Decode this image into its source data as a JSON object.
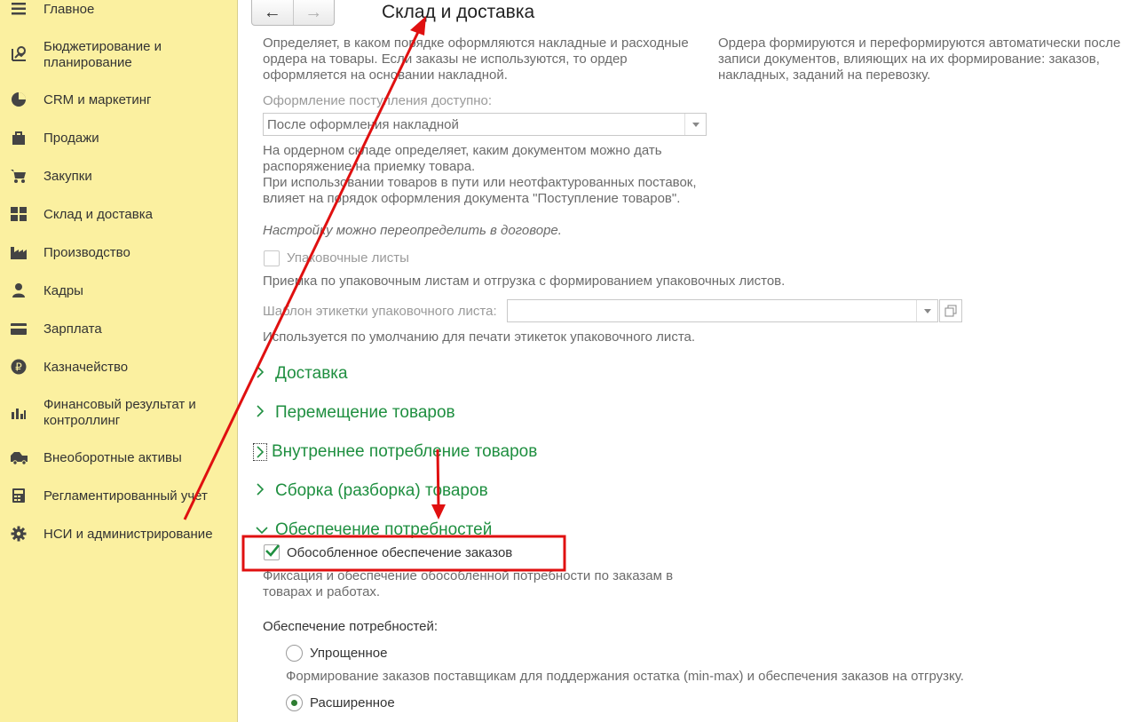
{
  "sidebar": {
    "items": [
      {
        "label": "Главное",
        "icon": "menu-icon"
      },
      {
        "label": "Бюджетирование и планирование",
        "icon": "budget-icon"
      },
      {
        "label": "CRM и маркетинг",
        "icon": "pie-chart-icon"
      },
      {
        "label": "Продажи",
        "icon": "shopping-bag-icon"
      },
      {
        "label": "Закупки",
        "icon": "cart-icon"
      },
      {
        "label": "Склад и доставка",
        "icon": "warehouse-icon"
      },
      {
        "label": "Производство",
        "icon": "factory-icon"
      },
      {
        "label": "Кадры",
        "icon": "person-icon"
      },
      {
        "label": "Зарплата",
        "icon": "card-icon"
      },
      {
        "label": "Казначейство",
        "icon": "ruble-icon"
      },
      {
        "label": "Финансовый результат и контроллинг",
        "icon": "bar-chart-icon"
      },
      {
        "label": "Внеоборотные активы",
        "icon": "truck-icon"
      },
      {
        "label": "Регламентированный учет",
        "icon": "calculator-icon"
      },
      {
        "label": "НСИ и администрирование",
        "icon": "gear-icon"
      }
    ]
  },
  "header": {
    "title": "Склад и доставка",
    "back": "←",
    "forward": "→"
  },
  "content": {
    "desc_left": "Определяет, в каком порядке оформляются накладные и расходные ордера на товары. Если заказы не используются, то ордер оформляется на основании накладной.",
    "desc_right": "Ордера формируются и переформируются автоматически после записи документов, влияющих на их формирование: заказов, накладных, заданий на перевозку.",
    "receipt_label": "Оформление поступления доступно:",
    "receipt_value": "После оформления накладной",
    "receipt_note1": "На ордерном складе определяет, каким документом можно дать распоряжение на приемку товара.",
    "receipt_note2": "При использовании товаров в пути или неотфактурованных поставок, влияет на порядок оформления документа \"Поступление товаров\".",
    "receipt_note3": "Настройку можно переопределить в договоре.",
    "packing_label": "Упаковочные листы",
    "packing_note": "Приемка по упаковочным листам и отгрузка с формированием упаковочных листов.",
    "template_label": "Шаблон этикетки упаковочного листа:",
    "template_note": "Используется по умолчанию для печати этикеток упаковочного листа.",
    "sections": [
      "Доставка",
      "Перемещение товаров",
      "Внутреннее потребление товаров",
      "Сборка (разборка) товаров",
      "Обеспечение потребностей"
    ],
    "separate_label": "Обособленное обеспечение заказов",
    "separate_note": "Фиксация и обеспечение обособленной потребности по заказам в товарах и работах.",
    "needs_label": "Обеспечение потребностей:",
    "simple_label": "Упрощенное",
    "simple_note": "Формирование заказов поставщикам для поддержания остатка (min-max) и обеспечения заказов на отгрузку.",
    "extended_label": "Расширенное"
  },
  "colors": {
    "sidebar_bg": "#fbf0a0",
    "section": "#1f8f40",
    "annotation_red": "#e01010"
  }
}
